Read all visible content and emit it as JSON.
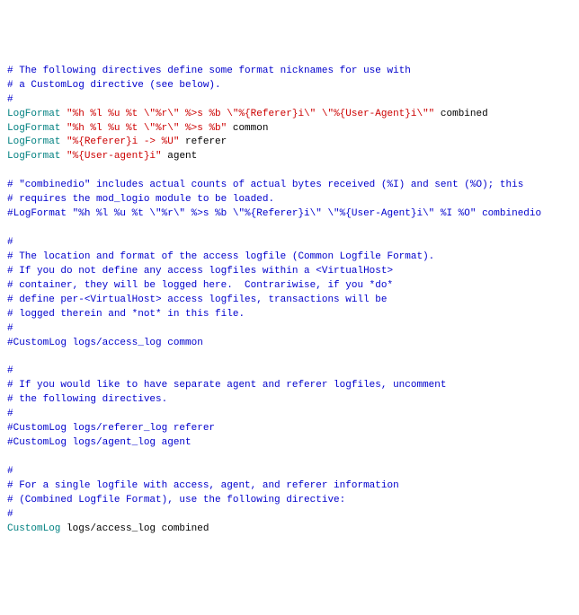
{
  "lines": [
    [
      {
        "cls": "comment",
        "t": "# The following directives define some format nicknames for use with"
      }
    ],
    [
      {
        "cls": "comment",
        "t": "# a CustomLog directive (see below)."
      }
    ],
    [
      {
        "cls": "comment",
        "t": "#"
      }
    ],
    [
      {
        "cls": "directive",
        "t": "LogFormat "
      },
      {
        "cls": "string",
        "t": "\"%h %l %u %t \\\"%r\\\" %>s %b \\\"%{Referer}i\\\" \\\"%{User-Agent}i\\\"\""
      },
      {
        "cls": "keyword",
        "t": " combined"
      }
    ],
    [
      {
        "cls": "directive",
        "t": "LogFormat "
      },
      {
        "cls": "string",
        "t": "\"%h %l %u %t \\\"%r\\\" %>s %b\""
      },
      {
        "cls": "keyword",
        "t": " common"
      }
    ],
    [
      {
        "cls": "directive",
        "t": "LogFormat "
      },
      {
        "cls": "string",
        "t": "\"%{Referer}i -> %U\""
      },
      {
        "cls": "keyword",
        "t": " referer"
      }
    ],
    [
      {
        "cls": "directive",
        "t": "LogFormat "
      },
      {
        "cls": "string",
        "t": "\"%{User-agent}i\""
      },
      {
        "cls": "keyword",
        "t": " agent"
      }
    ],
    [
      {
        "cls": "plain",
        "t": " "
      }
    ],
    [
      {
        "cls": "comment",
        "t": "# \"combinedio\" includes actual counts of actual bytes received (%I) and sent (%O); this"
      }
    ],
    [
      {
        "cls": "comment",
        "t": "# requires the mod_logio module to be loaded."
      }
    ],
    [
      {
        "cls": "comment",
        "t": "#LogFormat \"%h %l %u %t \\\"%r\\\" %>s %b \\\"%{Referer}i\\\" \\\"%{User-Agent}i\\\" %I %O\" combinedio"
      }
    ],
    [
      {
        "cls": "plain",
        "t": " "
      }
    ],
    [
      {
        "cls": "comment",
        "t": "#"
      }
    ],
    [
      {
        "cls": "comment",
        "t": "# The location and format of the access logfile (Common Logfile Format)."
      }
    ],
    [
      {
        "cls": "comment",
        "t": "# If you do not define any access logfiles within a <VirtualHost>"
      }
    ],
    [
      {
        "cls": "comment",
        "t": "# container, they will be logged here.  Contrariwise, if you *do*"
      }
    ],
    [
      {
        "cls": "comment",
        "t": "# define per-<VirtualHost> access logfiles, transactions will be"
      }
    ],
    [
      {
        "cls": "comment",
        "t": "# logged therein and *not* in this file."
      }
    ],
    [
      {
        "cls": "comment",
        "t": "#"
      }
    ],
    [
      {
        "cls": "comment",
        "t": "#CustomLog logs/access_log common"
      }
    ],
    [
      {
        "cls": "plain",
        "t": " "
      }
    ],
    [
      {
        "cls": "comment",
        "t": "#"
      }
    ],
    [
      {
        "cls": "comment",
        "t": "# If you would like to have separate agent and referer logfiles, uncomment"
      }
    ],
    [
      {
        "cls": "comment",
        "t": "# the following directives."
      }
    ],
    [
      {
        "cls": "comment",
        "t": "#"
      }
    ],
    [
      {
        "cls": "comment",
        "t": "#CustomLog logs/referer_log referer"
      }
    ],
    [
      {
        "cls": "comment",
        "t": "#CustomLog logs/agent_log agent"
      }
    ],
    [
      {
        "cls": "plain",
        "t": " "
      }
    ],
    [
      {
        "cls": "comment",
        "t": "#"
      }
    ],
    [
      {
        "cls": "comment",
        "t": "# For a single logfile with access, agent, and referer information"
      }
    ],
    [
      {
        "cls": "comment",
        "t": "# (Combined Logfile Format), use the following directive:"
      }
    ],
    [
      {
        "cls": "comment",
        "t": "#"
      }
    ],
    [
      {
        "cls": "directive",
        "t": "CustomLog "
      },
      {
        "cls": "plain",
        "t": "logs/access_log combined"
      }
    ]
  ]
}
